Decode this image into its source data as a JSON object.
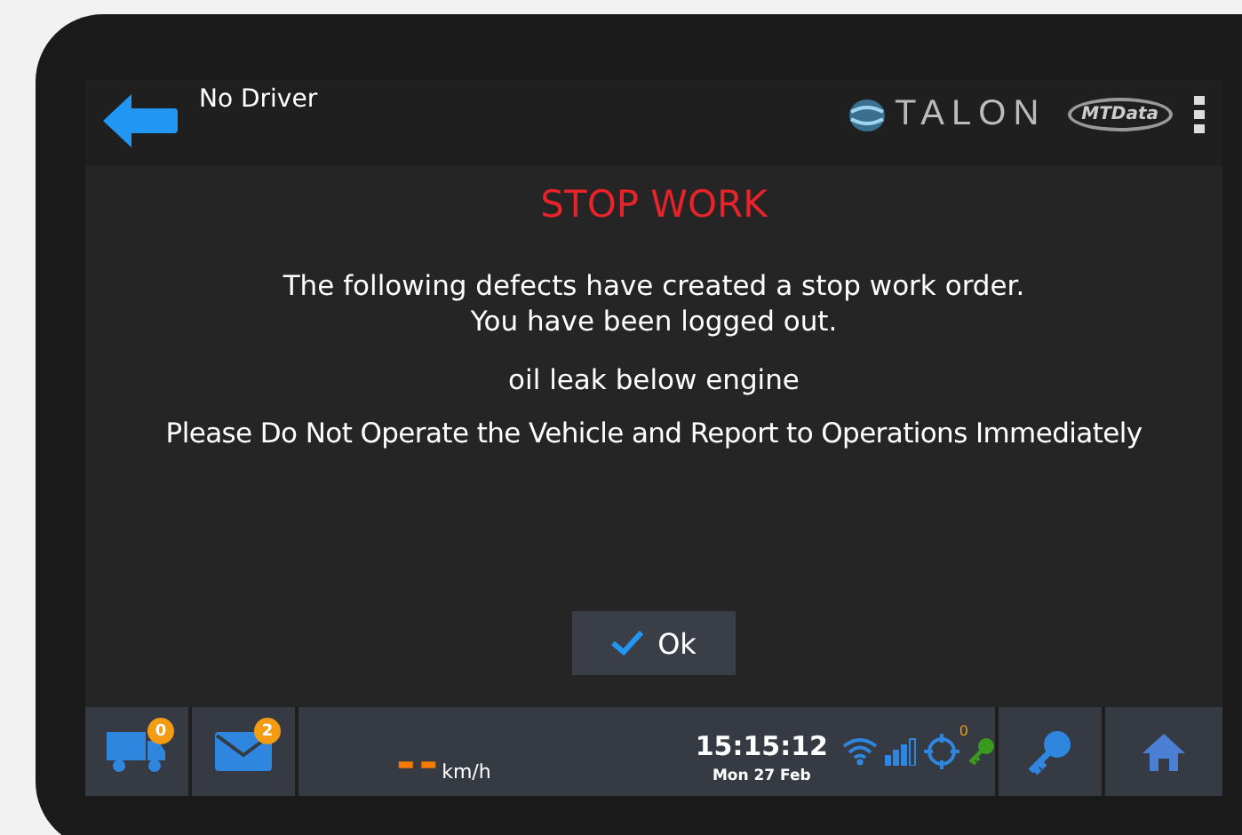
{
  "header": {
    "driver": "No Driver",
    "logo_text": "TALON",
    "brand": "MTData"
  },
  "dialog": {
    "title": "STOP WORK",
    "message_lines": [
      "The following defects have created a stop work order.",
      "You have been logged out."
    ],
    "defect": "oil leak below engine",
    "warning": "Please Do Not Operate the Vehicle and Report to Operations Immediately",
    "ok_button": "Ok"
  },
  "status_bar": {
    "jobs_badge": "0",
    "messages_badge": "2",
    "speed": "--",
    "speed_unit": "km/h",
    "time": "15:15:12",
    "date": "Mon 27 Feb",
    "gps_count": "0"
  }
}
